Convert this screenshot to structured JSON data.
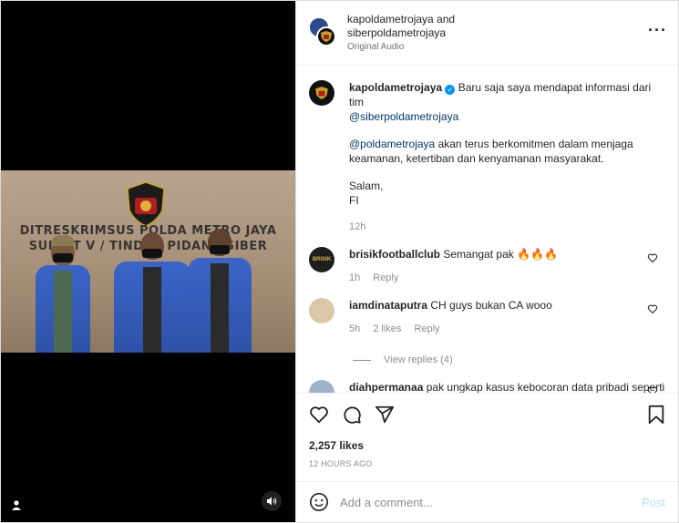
{
  "header": {
    "author1": "kapoldametrojaya",
    "and": " and",
    "author2": "siberpoldametrojaya",
    "audio": "Original Audio",
    "more_icon": "more-dots-icon"
  },
  "photo": {
    "banner_line1": "DITRESKRIMSUS POLDA METRO JAYA",
    "banner_line2": "SUBDIT V / TINDAK PIDANA SIBER",
    "emblem_text": "POLDA METRO JAYA"
  },
  "caption": {
    "username": "kapoldametrojaya",
    "line1": "Baru saja saya mendapat informasi dari tim",
    "mention1": "@siberpoldametrojaya",
    "mention2": "@poldametrojaya",
    "para2": " akan terus berkomitmen dalam menjaga keamanan, ketertiban dan kenyamanan masyarakat.",
    "salam": "Salam,",
    "sign": "FI",
    "time": "12h"
  },
  "comments": [
    {
      "username": "brisikfootballclub",
      "text": "Semangat pak 🔥🔥🔥",
      "time": "1h",
      "likes": "",
      "reply": "Reply"
    },
    {
      "username": "iamdinataputra",
      "text": "CH guys bukan CA wooo",
      "time": "5h",
      "likes": "2 likes",
      "reply": "Reply",
      "view_replies": "View replies (4)"
    },
    {
      "username": "diahpermanaa",
      "text": "pak ungkap kasus kebocoran data pribadi seperti ktp yg disalahgunakan dong😊",
      "time": "",
      "likes": "",
      "reply": ""
    }
  ],
  "stats": {
    "likes": "2,257 likes",
    "ago": "12 HOURS AGO"
  },
  "add_comment": {
    "placeholder": "Add a comment...",
    "post": "Post"
  },
  "colors": {
    "verified": "#0095f6",
    "link": "#00376b",
    "post_disabled": "#b2dffc"
  }
}
